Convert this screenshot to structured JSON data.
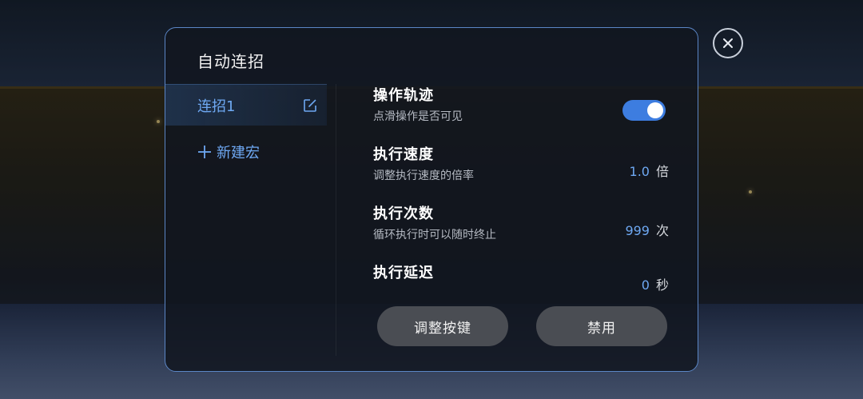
{
  "dialog": {
    "title": "自动连招"
  },
  "sidebar": {
    "items": [
      {
        "label": "连招1",
        "icon": "edit-icon",
        "active": true
      }
    ],
    "new_macro": {
      "label": "新建宏",
      "icon": "plus-icon"
    }
  },
  "settings": {
    "trail": {
      "title": "操作轨迹",
      "desc": "点滑操作是否可见",
      "enabled": true
    },
    "speed": {
      "title": "执行速度",
      "desc": "调整执行速度的倍率",
      "value": "1.0",
      "unit": "倍"
    },
    "count": {
      "title": "执行次数",
      "desc": "循环执行时可以随时终止",
      "value": "999",
      "unit": "次"
    },
    "delay": {
      "title": "执行延迟",
      "value": "0",
      "unit": "秒"
    }
  },
  "buttons": {
    "adjust_label": "调整按键",
    "disable_label": "禁用"
  },
  "colors": {
    "accent": "#6ea8f2",
    "toggle_on": "#3d7de0",
    "dialog_border": "#5b86c6",
    "button_bg": "#4a4d53"
  }
}
